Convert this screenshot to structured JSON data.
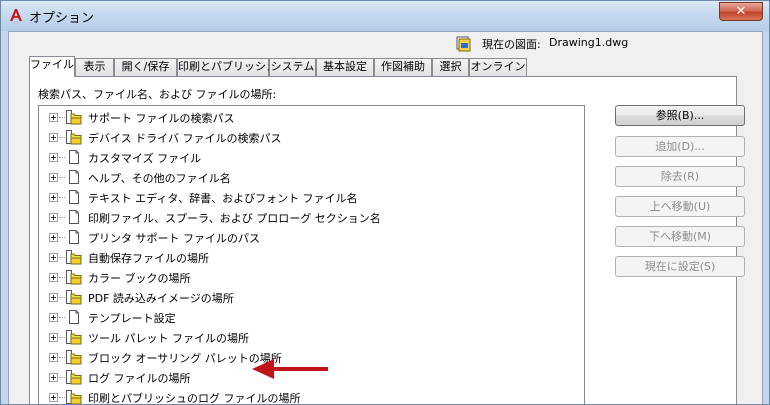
{
  "window": {
    "title": "オプション",
    "close_glyph": "✕",
    "current_drawing_label": "現在の図面:",
    "current_drawing_name": "Drawing1.dwg"
  },
  "tabs": [
    {
      "label": "ファイル",
      "active": true
    },
    {
      "label": "表示"
    },
    {
      "label": "開く/保存"
    },
    {
      "label": "印刷とパブリッシュ"
    },
    {
      "label": "システム"
    },
    {
      "label": "基本設定"
    },
    {
      "label": "作図補助"
    },
    {
      "label": "選択"
    },
    {
      "label": "オンライン"
    }
  ],
  "panel": {
    "label": "検索パス、ファイル名、および ファイルの場所:"
  },
  "tree": {
    "items": [
      {
        "label": "サポート ファイルの検索パス",
        "icon": "folder-stack-icon"
      },
      {
        "label": "デバイス ドライバ ファイルの検索パス",
        "icon": "folder-stack-icon"
      },
      {
        "label": "カスタマイズ ファイル",
        "icon": "document-icon"
      },
      {
        "label": "ヘルプ、その他のファイル名",
        "icon": "document-icon"
      },
      {
        "label": "テキスト エディタ、辞書、およびフォント ファイル名",
        "icon": "document-icon"
      },
      {
        "label": "印刷ファイル、スプーラ、および プロローグ セクション名",
        "icon": "document-icon"
      },
      {
        "label": "プリンタ サポート ファイルのパス",
        "icon": "document-icon"
      },
      {
        "label": "自動保存ファイルの場所",
        "icon": "folder-stack-icon"
      },
      {
        "label": "カラー ブックの場所",
        "icon": "folder-stack-icon"
      },
      {
        "label": "PDF 読み込みイメージの場所",
        "icon": "folder-stack-icon"
      },
      {
        "label": "テンプレート設定",
        "icon": "document-icon"
      },
      {
        "label": "ツール パレット ファイルの場所",
        "icon": "folder-stack-icon"
      },
      {
        "label": "ブロック オーサリング パレットの場所",
        "icon": "folder-stack-icon"
      },
      {
        "label": "ログ ファイルの場所",
        "icon": "folder-stack-icon"
      },
      {
        "label": "印刷とパブリッシュのログ ファイルの場所",
        "icon": "folder-stack-icon"
      }
    ]
  },
  "buttons": {
    "browse": "参照(B)...",
    "add": "追加(D)...",
    "remove": "除去(R)",
    "move_up": "上へ移動(U)",
    "move_down": "下へ移動(M)",
    "set_current": "現在に設定(S)"
  },
  "colors": {
    "arrow": "#c0161a",
    "folder": "#f7e04a",
    "title_bar": "#c5d9ef"
  }
}
